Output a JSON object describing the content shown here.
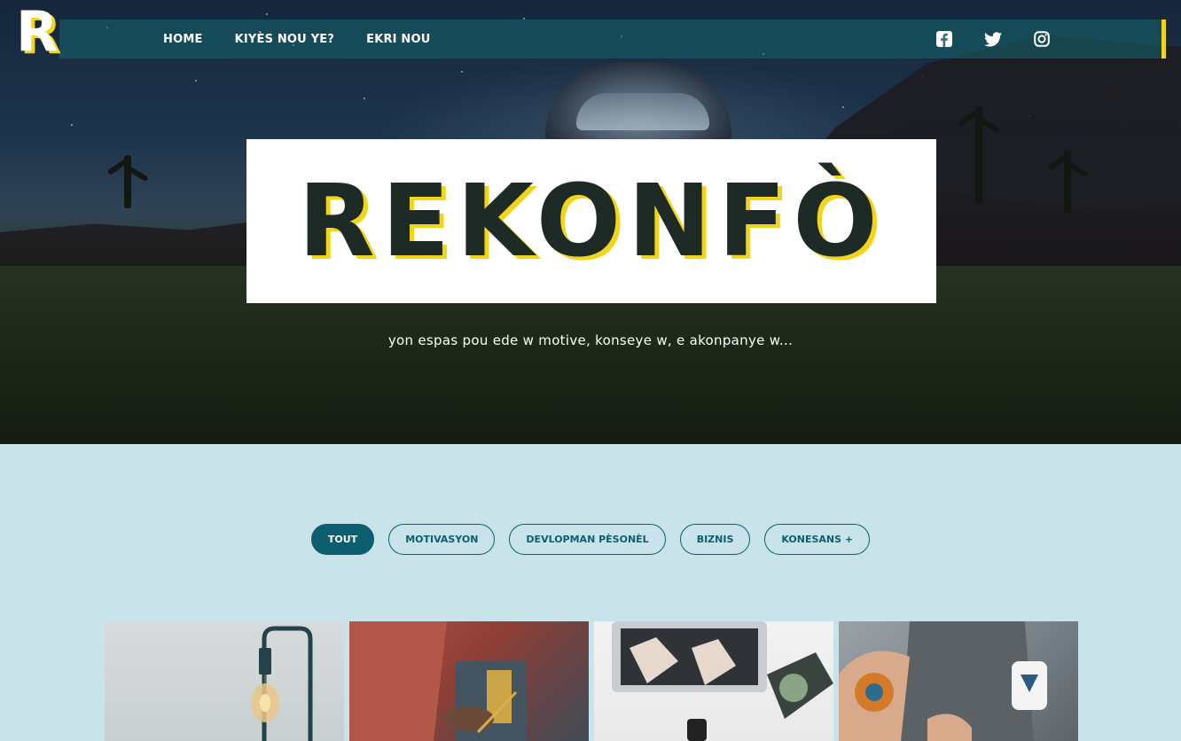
{
  "logo": {
    "letter": "R"
  },
  "nav": {
    "links": [
      "HOME",
      "KIYÈS NOU YE?",
      "EKRI NOU"
    ]
  },
  "social": {
    "icons": [
      "facebook-icon",
      "twitter-icon",
      "instagram-icon"
    ]
  },
  "hero": {
    "title": "REKONFÒ",
    "tagline": "yon espas pou ede w motive, konseye w, e akonpanye w..."
  },
  "filters": {
    "items": [
      "TOUT",
      "MOTIVASYON",
      "DEVLOPMAN PÈSONÈL",
      "BIZNIS",
      "KONESANS +"
    ],
    "active": "TOUT"
  },
  "colors": {
    "accent": "#f2d41a",
    "teal": "#0d5e6e",
    "section_bg": "#c8e4ea"
  }
}
